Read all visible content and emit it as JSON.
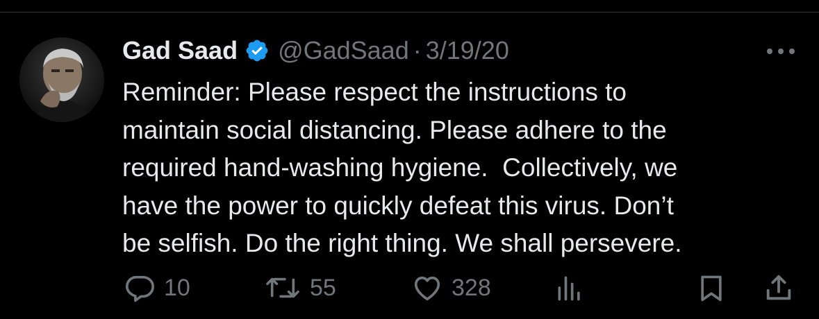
{
  "tweet": {
    "display_name": "Gad Saad",
    "handle": "@GadSaad",
    "separator": "·",
    "date": "3/19/20",
    "verified_color": "#1d9bf0",
    "text": "Reminder: Please respect the instructions to\nmaintain social distancing. Please adhere to the\nrequired hand-washing hygiene.  Collectively, we\nhave the power to quickly defeat this virus. Don’t\nbe selfish. Do the right thing. We shall persevere."
  },
  "actions": {
    "replies": "10",
    "reposts": "55",
    "likes": "328"
  },
  "icons": {
    "verified": "verified-badge-icon",
    "more": "more-horizontal-icon",
    "reply": "reply-icon",
    "repost": "repost-icon",
    "like": "heart-icon",
    "views": "views-icon",
    "bookmark": "bookmark-icon",
    "share": "share-icon"
  }
}
